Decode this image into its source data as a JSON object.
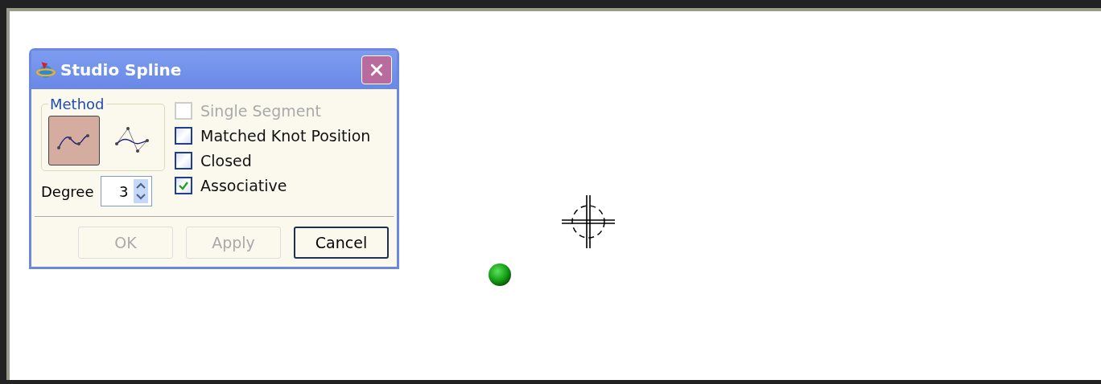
{
  "dialog": {
    "title": "Studio Spline",
    "method": {
      "label": "Method",
      "options": [
        {
          "kind": "through-points",
          "selected": true
        },
        {
          "kind": "by-poles",
          "selected": false
        }
      ]
    },
    "degree": {
      "label": "Degree",
      "value": "3"
    },
    "checkboxes": [
      {
        "label": "Single Segment",
        "checked": false,
        "disabled": true
      },
      {
        "label": "Matched Knot Position",
        "checked": false,
        "disabled": false
      },
      {
        "label": "Closed",
        "checked": false,
        "disabled": false
      },
      {
        "label": "Associative",
        "checked": true,
        "disabled": false
      }
    ],
    "buttons": [
      {
        "label": "OK",
        "disabled": true,
        "default": false
      },
      {
        "label": "Apply",
        "disabled": true,
        "default": false
      },
      {
        "label": "Cancel",
        "disabled": false,
        "default": true
      }
    ]
  }
}
